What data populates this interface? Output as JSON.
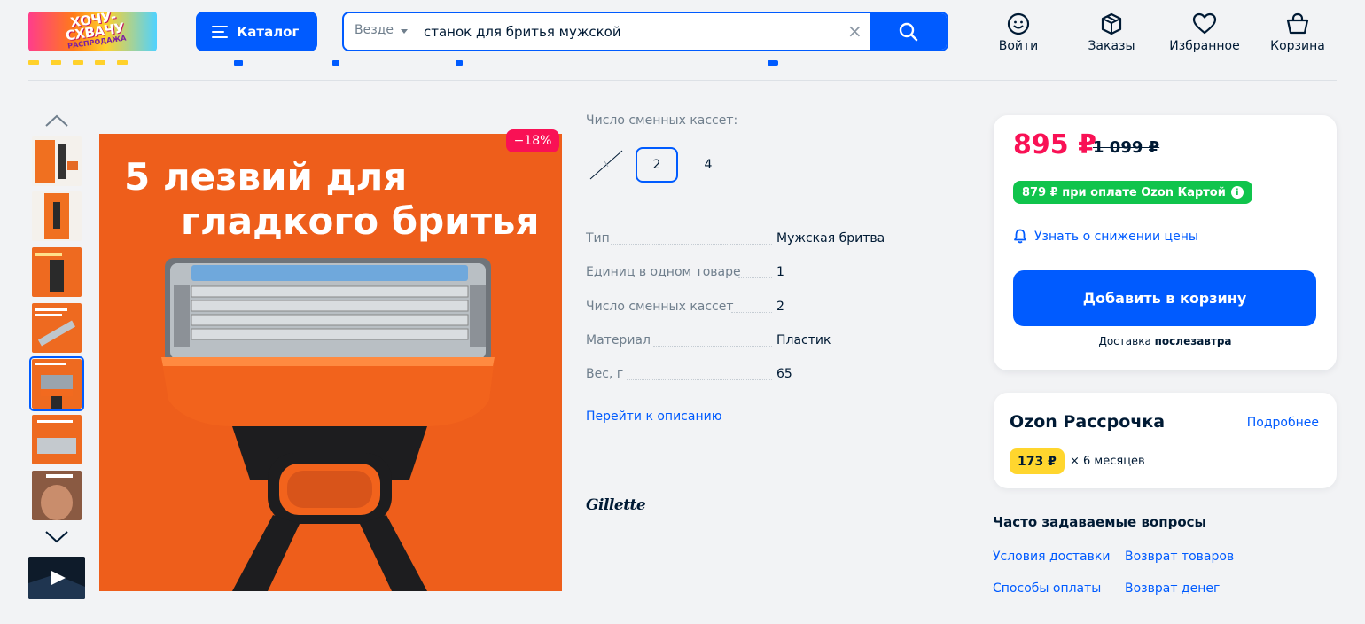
{
  "header": {
    "logo_text": "ХОЧУ- СХВАЧУ",
    "logo_sub": "РАСПРОДАЖА",
    "catalog_label": "Каталог",
    "search": {
      "scope": "Везде",
      "value": "станок для бритья мужской"
    },
    "nav": [
      {
        "label": "Войти",
        "icon": "user-icon"
      },
      {
        "label": "Заказы",
        "icon": "box-icon"
      },
      {
        "label": "Избранное",
        "icon": "heart-icon"
      },
      {
        "label": "Корзина",
        "icon": "cart-icon"
      }
    ]
  },
  "gallery": {
    "active_index": 4,
    "thumbnails": [
      "product-photo",
      "package-photo",
      "promo-photo",
      "cassettes-photo",
      "blades-photo",
      "cartridge-photo",
      "model-photo"
    ],
    "video_thumb": "play-icon"
  },
  "main_image": {
    "headline_line1": "5 лезвий для",
    "headline_line2": "гладкого бритья",
    "discount": "−18%"
  },
  "variants": {
    "title": "Число сменных кассет:",
    "options": [
      {
        "label": "",
        "state": "unavailable"
      },
      {
        "label": "2",
        "state": "selected"
      },
      {
        "label": "4",
        "state": "normal"
      }
    ]
  },
  "specs": [
    {
      "key": "Тип",
      "value": "Мужская бритва"
    },
    {
      "key": "Единиц в одном товаре",
      "value": "1"
    },
    {
      "key": "Число сменных кассет",
      "value": "2"
    },
    {
      "key": "Материал",
      "value": "Пластик"
    },
    {
      "key": "Вес, г",
      "value": "65"
    }
  ],
  "goto_description": "Перейти к описанию",
  "brand": "Gillette",
  "buy": {
    "price": "895 ₽",
    "old_price": "1 099 ₽",
    "card_price_text": "879 ₽ при оплате Ozon Картой",
    "notify_text": "Узнать о снижении цены",
    "add_to_cart": "Добавить в корзину",
    "delivery_prefix": "Доставка",
    "delivery_when": "послезавтра"
  },
  "installment": {
    "title": "Ozon Рассрочка",
    "more": "Подробнее",
    "amount": "173 ₽",
    "months": "× 6 месяцев"
  },
  "faq": {
    "title": "Часто задаваемые вопросы",
    "links": [
      "Условия доставки",
      "Возврат товаров",
      "Способы оплаты",
      "Возврат денег"
    ]
  },
  "colors": {
    "brand_blue": "#005bff",
    "price_red": "#f91155",
    "ozon_card_green": "#10c44c",
    "installment_yellow": "#ffd62e",
    "image_orange": "#ee5e1b"
  }
}
